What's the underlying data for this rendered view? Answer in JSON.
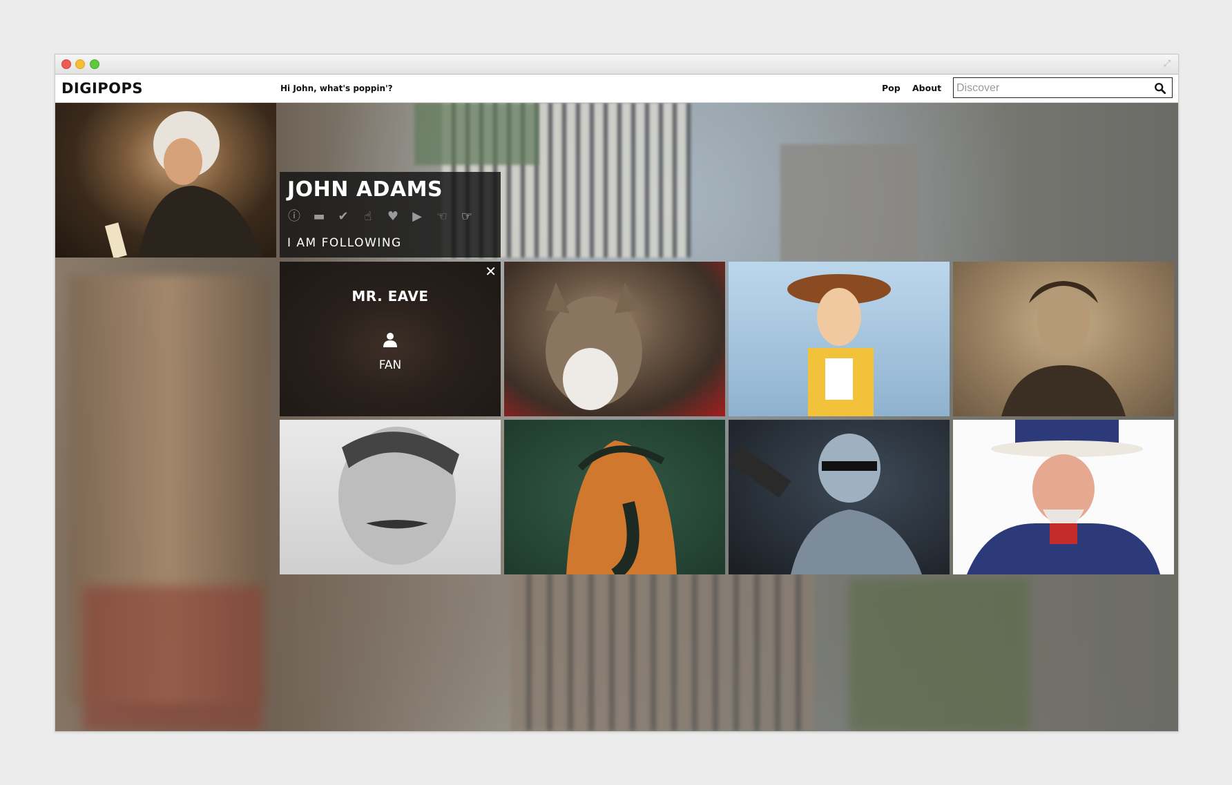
{
  "app": {
    "logo": "DIGIPOPS",
    "greeting": "Hi John, what's poppin'?"
  },
  "nav": {
    "pop": "Pop",
    "about": "About"
  },
  "search": {
    "placeholder": "Discover"
  },
  "profile": {
    "name": "JOHN ADAMS",
    "subtitle": "I AM FOLLOWING",
    "icons": [
      "info-icon",
      "briefcase-icon",
      "check-icon",
      "thumbs-up-icon",
      "heart-icon",
      "play-icon",
      "hand-point-icon",
      "hand-point-right-icon"
    ]
  },
  "fan_card": {
    "name": "MR. EAVE",
    "label": "FAN",
    "close": "✕"
  },
  "grid": [
    {
      "name": "fan-card-tile",
      "color": "#3a2e25"
    },
    {
      "name": "cat-tile",
      "color": "#5b4a3c"
    },
    {
      "name": "woody-tile",
      "color": "#9fc3e0"
    },
    {
      "name": "lewis-carroll-tile",
      "color": "#8a7358"
    },
    {
      "name": "tesla-tile",
      "color": "#bdbdbd"
    },
    {
      "name": "greek-vase-tile",
      "color": "#2d4a3a"
    },
    {
      "name": "robocop-tile",
      "color": "#2b2f36"
    },
    {
      "name": "uncle-sam-tile",
      "color": "#e9e6e2"
    }
  ],
  "colors": {
    "accent": "#111111",
    "overlay": "#141414",
    "icon_inactive": "#9a9a9a"
  }
}
